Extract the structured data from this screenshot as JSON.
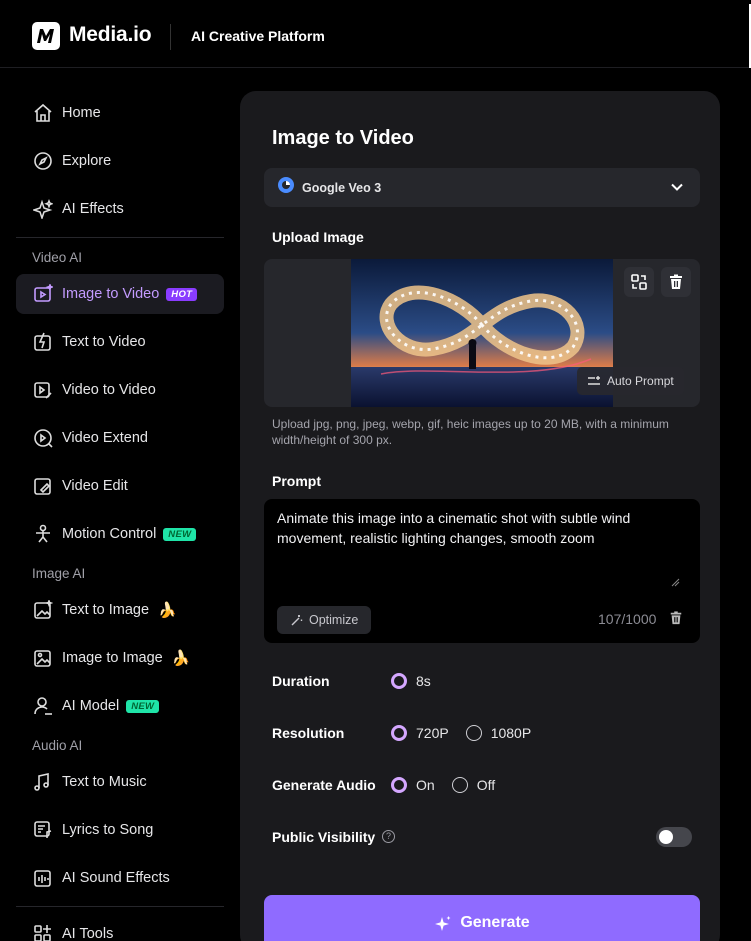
{
  "header": {
    "brand": "Media.io",
    "platform": "AI Creative Platform"
  },
  "sidebar": {
    "top_items": [
      {
        "label": "Home",
        "icon": "home-icon"
      },
      {
        "label": "Explore",
        "icon": "compass-icon"
      },
      {
        "label": "AI Effects",
        "icon": "sparkle-icon"
      }
    ],
    "video_section": "Video AI",
    "video_items": [
      {
        "label": "Image to Video",
        "icon": "image-to-video-icon",
        "badge": "HOT",
        "active": true
      },
      {
        "label": "Text to Video",
        "icon": "text-to-video-icon"
      },
      {
        "label": "Video to Video",
        "icon": "video-to-video-icon"
      },
      {
        "label": "Video Extend",
        "icon": "video-extend-icon"
      },
      {
        "label": "Video Edit",
        "icon": "video-edit-icon"
      },
      {
        "label": "Motion Control",
        "icon": "motion-control-icon",
        "badge": "NEW"
      }
    ],
    "image_section": "Image AI",
    "image_items": [
      {
        "label": "Text to Image",
        "icon": "text-to-image-icon",
        "emoji": "🍌"
      },
      {
        "label": "Image to Image",
        "icon": "image-to-image-icon",
        "emoji": "🍌"
      },
      {
        "label": "AI Model",
        "icon": "ai-model-icon",
        "badge": "NEW"
      }
    ],
    "audio_section": "Audio AI",
    "audio_items": [
      {
        "label": "Text to Music",
        "icon": "music-icon"
      },
      {
        "label": "Lyrics to Song",
        "icon": "lyrics-icon"
      },
      {
        "label": "AI Sound Effects",
        "icon": "sound-effects-icon"
      }
    ],
    "bottom_items": [
      {
        "label": "AI Tools",
        "icon": "tools-grid-icon"
      }
    ]
  },
  "main": {
    "title": "Image to Video",
    "model": "Google Veo 3",
    "upload_label": "Upload Image",
    "auto_prompt": "Auto Prompt",
    "upload_hint": "Upload jpg, png, jpeg, webp, gif, heic images up to 20 MB, with a minimum width/height of 300 px.",
    "prompt_label": "Prompt",
    "prompt_text": "Animate this image into a cinematic shot with subtle wind movement, realistic lighting changes, smooth zoom",
    "optimize": "Optimize",
    "counter": "107/1000",
    "duration_label": "Duration",
    "duration_options": [
      "8s"
    ],
    "resolution_label": "Resolution",
    "resolution_options": [
      "720P",
      "1080P"
    ],
    "audio_label": "Generate Audio",
    "audio_options": [
      "On",
      "Off"
    ],
    "visibility_label": "Public Visibility",
    "visibility_help": "?",
    "generate": "Generate"
  },
  "colors": {
    "accent": "#8f6bff",
    "active_text": "#c39bff",
    "hot_badge": "#8a3cff",
    "new_badge": "#1fe4a8",
    "panel": "#1a1a1d"
  }
}
